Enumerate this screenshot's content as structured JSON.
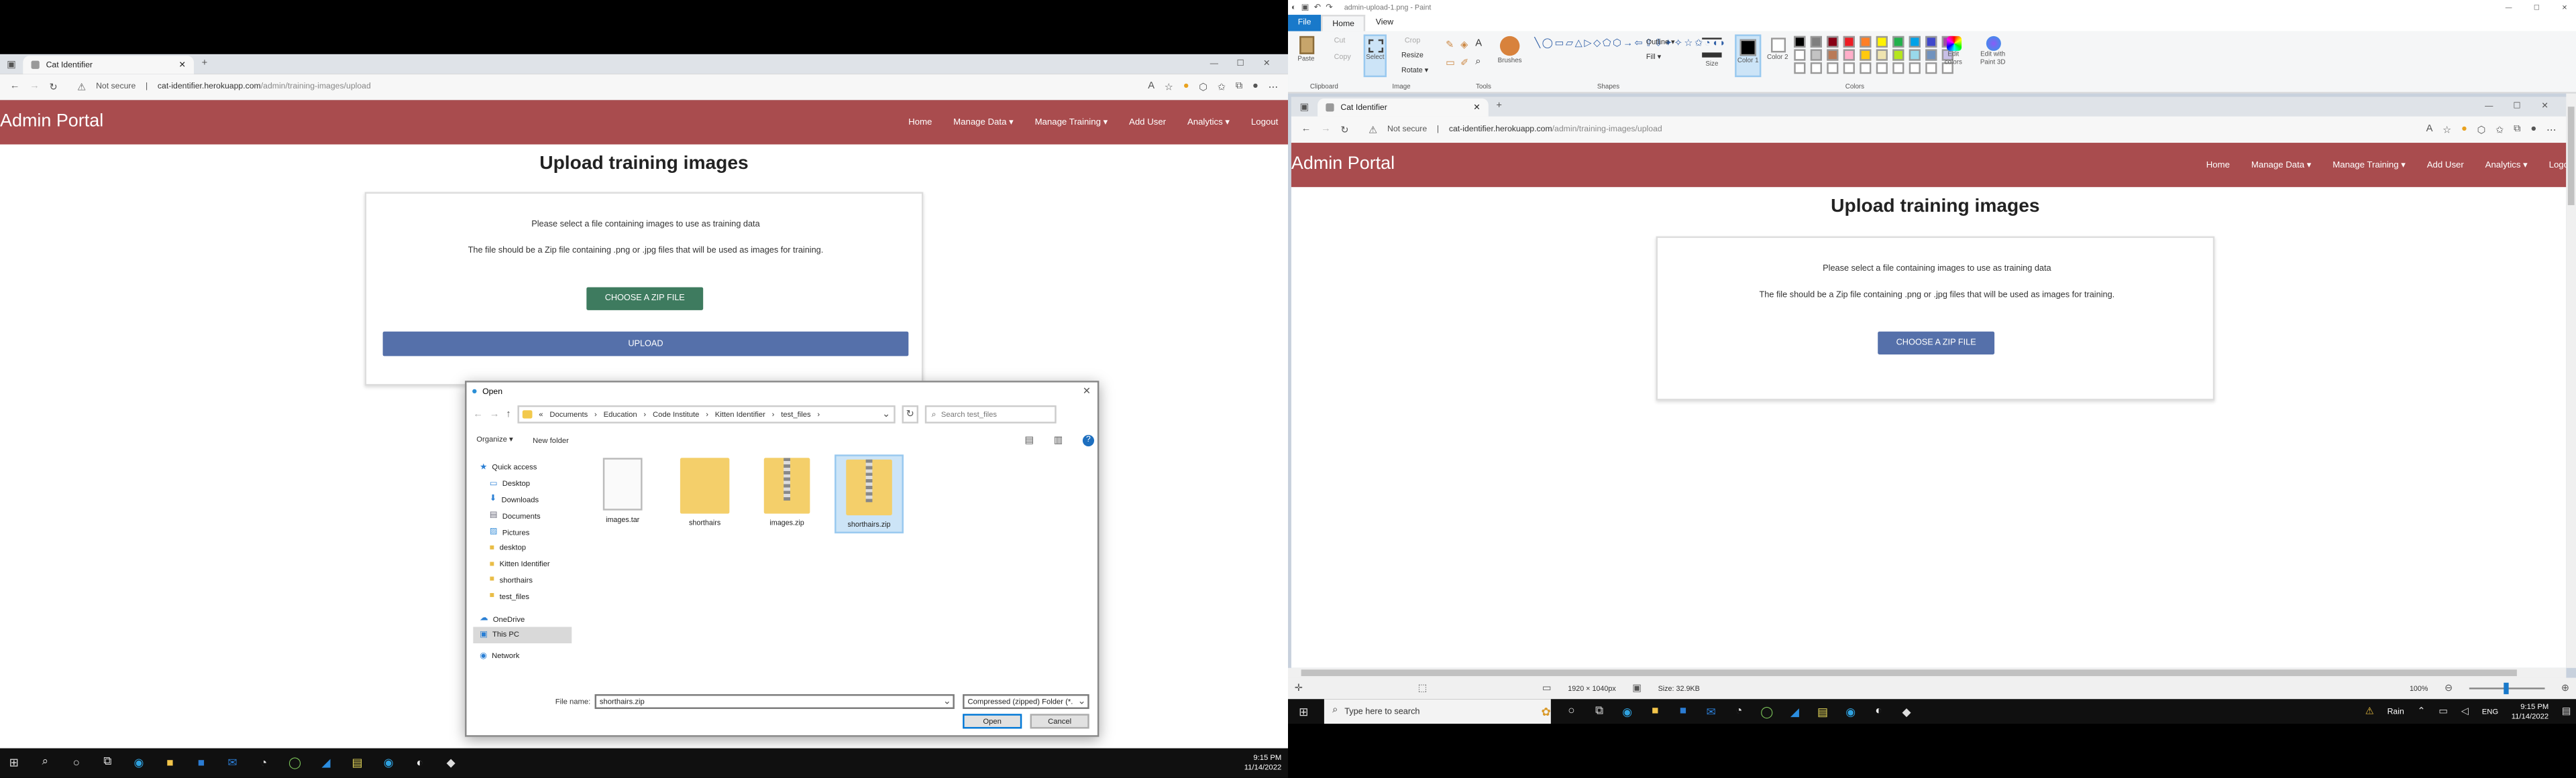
{
  "left_browser": {
    "tab_title": "Cat Identifier",
    "not_secure": "Not secure",
    "url_host": "cat-identifier.herokuapp.com",
    "url_path": "/admin/training-images/upload",
    "brand": "Admin Portal",
    "nav": [
      "Home",
      "Manage Data ▾",
      "Manage Training ▾",
      "Add User",
      "Analytics ▾",
      "Logout"
    ],
    "page_title": "Upload training images",
    "para1": "Please select a file containing images to use as training data",
    "para2": "The file should be a Zip file containing .png or .jpg files that will be used as images for training.",
    "choose_label": "CHOOSE A ZIP FILE",
    "upload_label": "UPLOAD"
  },
  "dialog": {
    "title": "Open",
    "breadcrumb": [
      "Documents",
      "Education",
      "Code Institute",
      "Kitten Identifier",
      "test_files"
    ],
    "search_placeholder": "Search test_files",
    "organize": "Organize ▾",
    "new_folder": "New folder",
    "sidebar": [
      {
        "label": "Quick access",
        "icon": "star-icon"
      },
      {
        "label": "Desktop",
        "icon": "desktop-icon"
      },
      {
        "label": "Downloads",
        "icon": "download-icon"
      },
      {
        "label": "Documents",
        "icon": "documents-icon"
      },
      {
        "label": "Pictures",
        "icon": "pictures-icon"
      },
      {
        "label": "desktop",
        "icon": "folder-icon"
      },
      {
        "label": "Kitten Identifier",
        "icon": "folder-icon"
      },
      {
        "label": "shorthairs",
        "icon": "folder-icon"
      },
      {
        "label": "test_files",
        "icon": "folder-icon"
      },
      {
        "label": "OneDrive",
        "icon": "cloud-icon"
      },
      {
        "label": "This PC",
        "icon": "pc-icon"
      },
      {
        "label": "Network",
        "icon": "network-icon"
      }
    ],
    "files": [
      {
        "name": "images.tar",
        "kind": "doc"
      },
      {
        "name": "shorthairs",
        "kind": "folder"
      },
      {
        "name": "images.zip",
        "kind": "zip"
      },
      {
        "name": "shorthairs.zip",
        "kind": "zip",
        "selected": true
      }
    ],
    "filename_label": "File name:",
    "filename_value": "shorthairs.zip",
    "filetype": "Compressed (zipped) Folder (*.",
    "open_label": "Open",
    "cancel_label": "Cancel"
  },
  "taskbar_left": {
    "time": "9:15 PM",
    "date": "11/14/2022"
  },
  "paint": {
    "title": "admin-upload-1.png - Paint",
    "tabs": [
      "File",
      "Home",
      "View"
    ],
    "groups": [
      "Clipboard",
      "Image",
      "Tools",
      "Shapes",
      "Colors"
    ],
    "paste": "Paste",
    "cut": "Cut",
    "copy": "Copy",
    "select": "Select",
    "crop": "Crop",
    "resize": "Resize",
    "rotate": "Rotate ▾",
    "brushes": "Brushes",
    "outline": "Outline ▾",
    "fill": "Fill ▾",
    "size": "Size",
    "color1": "Color 1",
    "color2": "Color 2",
    "edit_colors": "Edit colors",
    "edit_paint3d": "Edit with Paint 3D",
    "palette": [
      "#000000",
      "#7f7f7f",
      "#880015",
      "#ed1c24",
      "#ff7f27",
      "#fff200",
      "#22b14c",
      "#00a2e8",
      "#3f48cc",
      "#a349a4",
      "#ffffff",
      "#c3c3c3",
      "#b97a57",
      "#ffaec9",
      "#ffc90e",
      "#efe4b0",
      "#b5e61d",
      "#99d9ea",
      "#7092be",
      "#c8bfe7"
    ],
    "status_dims": "1920 × 1040px",
    "status_size": "Size: 32.9KB",
    "zoom": "100%"
  },
  "right_browser": {
    "tab_title": "Cat Identifier",
    "not_secure": "Not secure",
    "url_host": "cat-identifier.herokuapp.com",
    "url_path": "/admin/training-images/upload",
    "brand": "Admin Portal",
    "nav": [
      "Home",
      "Manage Data ▾",
      "Manage Training ▾",
      "Add User",
      "Analytics ▾",
      "Logout"
    ],
    "page_title": "Upload training images",
    "para1": "Please select a file containing images to use as training data",
    "para2": "The file should be a Zip file containing .png or .jpg files that will be used as images for training.",
    "choose_label": "CHOOSE A ZIP FILE"
  },
  "taskbar_right": {
    "search_placeholder": "Type here to search",
    "weather": "Rain",
    "lang": "ENG",
    "time": "9:15 PM",
    "date": "11/14/2022"
  }
}
